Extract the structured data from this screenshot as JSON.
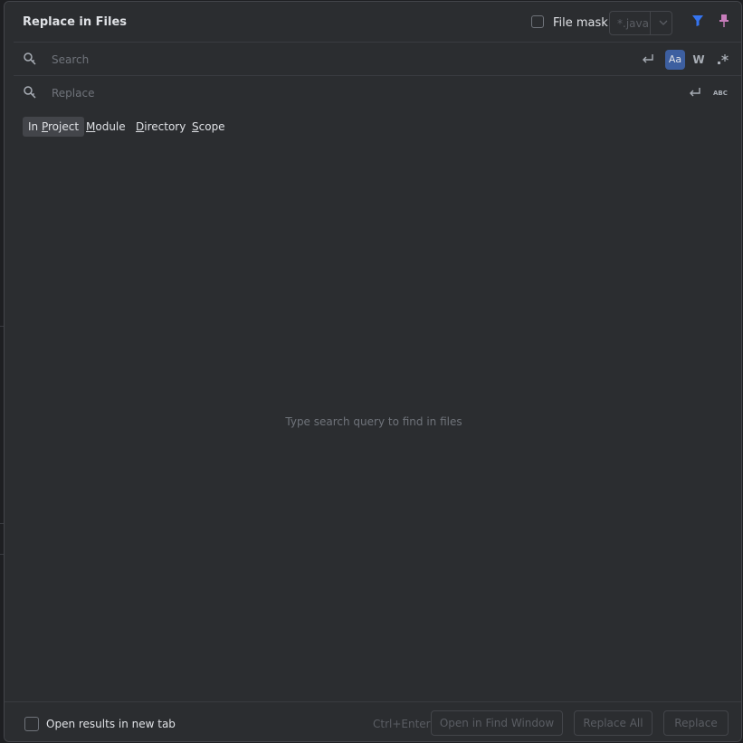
{
  "dialog": {
    "title": "Replace in Files",
    "file_mask": {
      "label": "File mask:",
      "value": "*.java",
      "checked": false
    },
    "icons": {
      "filter": "filter-icon",
      "pin": "pin-icon"
    }
  },
  "search": {
    "placeholder": "Search",
    "options": {
      "match_case": "Aa",
      "words": "W"
    }
  },
  "replace": {
    "placeholder": "Replace"
  },
  "scope_tabs": [
    {
      "label": "In Project",
      "active": true
    },
    {
      "label": "Module",
      "active": false
    },
    {
      "label": "Directory",
      "active": false
    },
    {
      "label": "Scope",
      "active": false
    }
  ],
  "empty_message": "Type search query to find in files",
  "footer": {
    "open_new_tab_label": "Open results in new tab",
    "shortcut": "Ctrl+Enter",
    "open_find_window": "Open in Find Window",
    "replace_all": "Replace All",
    "replace": "Replace"
  },
  "colors": {
    "dialog_bg": "#2b2d30",
    "accent_active": "#3d5fa0",
    "filter_icon": "#3574f0",
    "pin_icon": "#c77dbb"
  }
}
